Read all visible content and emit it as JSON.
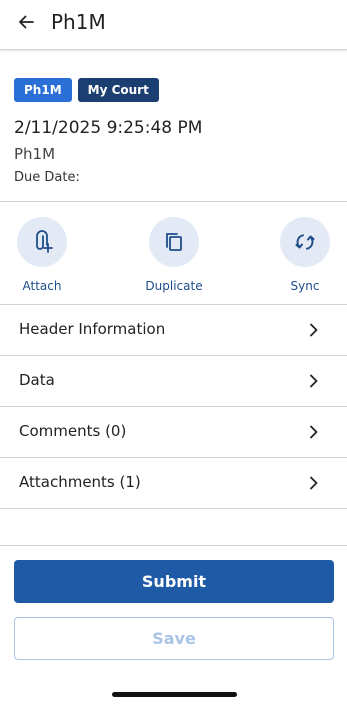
{
  "header": {
    "title": "Ph1M"
  },
  "summary": {
    "tags": [
      "Ph1M",
      "My Court"
    ],
    "datetime": "2/11/2025 9:25:48 PM",
    "subtitle": "Ph1M",
    "due_label": "Due Date:"
  },
  "actions": [
    {
      "label": "Attach",
      "icon": "attach-icon"
    },
    {
      "label": "Duplicate",
      "icon": "duplicate-icon"
    },
    {
      "label": "Sync",
      "icon": "sync-icon"
    }
  ],
  "menu": [
    {
      "label": "Header Information"
    },
    {
      "label": "Data"
    },
    {
      "label": "Comments (0)"
    },
    {
      "label": "Attachments (1)"
    }
  ],
  "buttons": {
    "submit": "Submit",
    "save": "Save"
  },
  "colors": {
    "primary": "#1e5aa6",
    "tag_primary": "#2a6fd6",
    "tag_secondary": "#1c3f72",
    "action_bg": "#e3eaf5",
    "disabled": "#a9c4e6"
  }
}
